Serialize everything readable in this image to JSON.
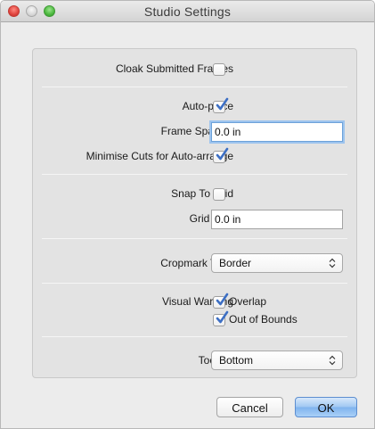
{
  "window": {
    "title": "Studio Settings"
  },
  "settings": {
    "cloak_submitted_frames": {
      "label": "Cloak Submitted Frames",
      "checked": false
    },
    "auto_place": {
      "label": "Auto-place",
      "checked": true
    },
    "frame_spacing": {
      "label": "Frame Spacing",
      "value": "0.0 in"
    },
    "minimise_cuts": {
      "label": "Minimise Cuts for Auto-arrange",
      "checked": true
    },
    "snap_to_grid": {
      "label": "Snap To Grid",
      "checked": false
    },
    "grid_size": {
      "label": "Grid Size",
      "value": "0.0 in"
    },
    "cropmark_type": {
      "label": "Cropmark Type",
      "selected": "Border"
    },
    "visual_warning": {
      "label": "Visual Warning",
      "options": [
        {
          "label": "Overlap",
          "checked": true
        },
        {
          "label": "Out of Bounds",
          "checked": true
        }
      ]
    },
    "toolbar": {
      "label": "Toolbar",
      "selected": "Bottom"
    }
  },
  "buttons": {
    "cancel": "Cancel",
    "ok": "OK"
  },
  "colors": {
    "accent": "#3d6fc4",
    "focus_ring": "#9dc4ee",
    "default_button": "#7fb3ee"
  }
}
